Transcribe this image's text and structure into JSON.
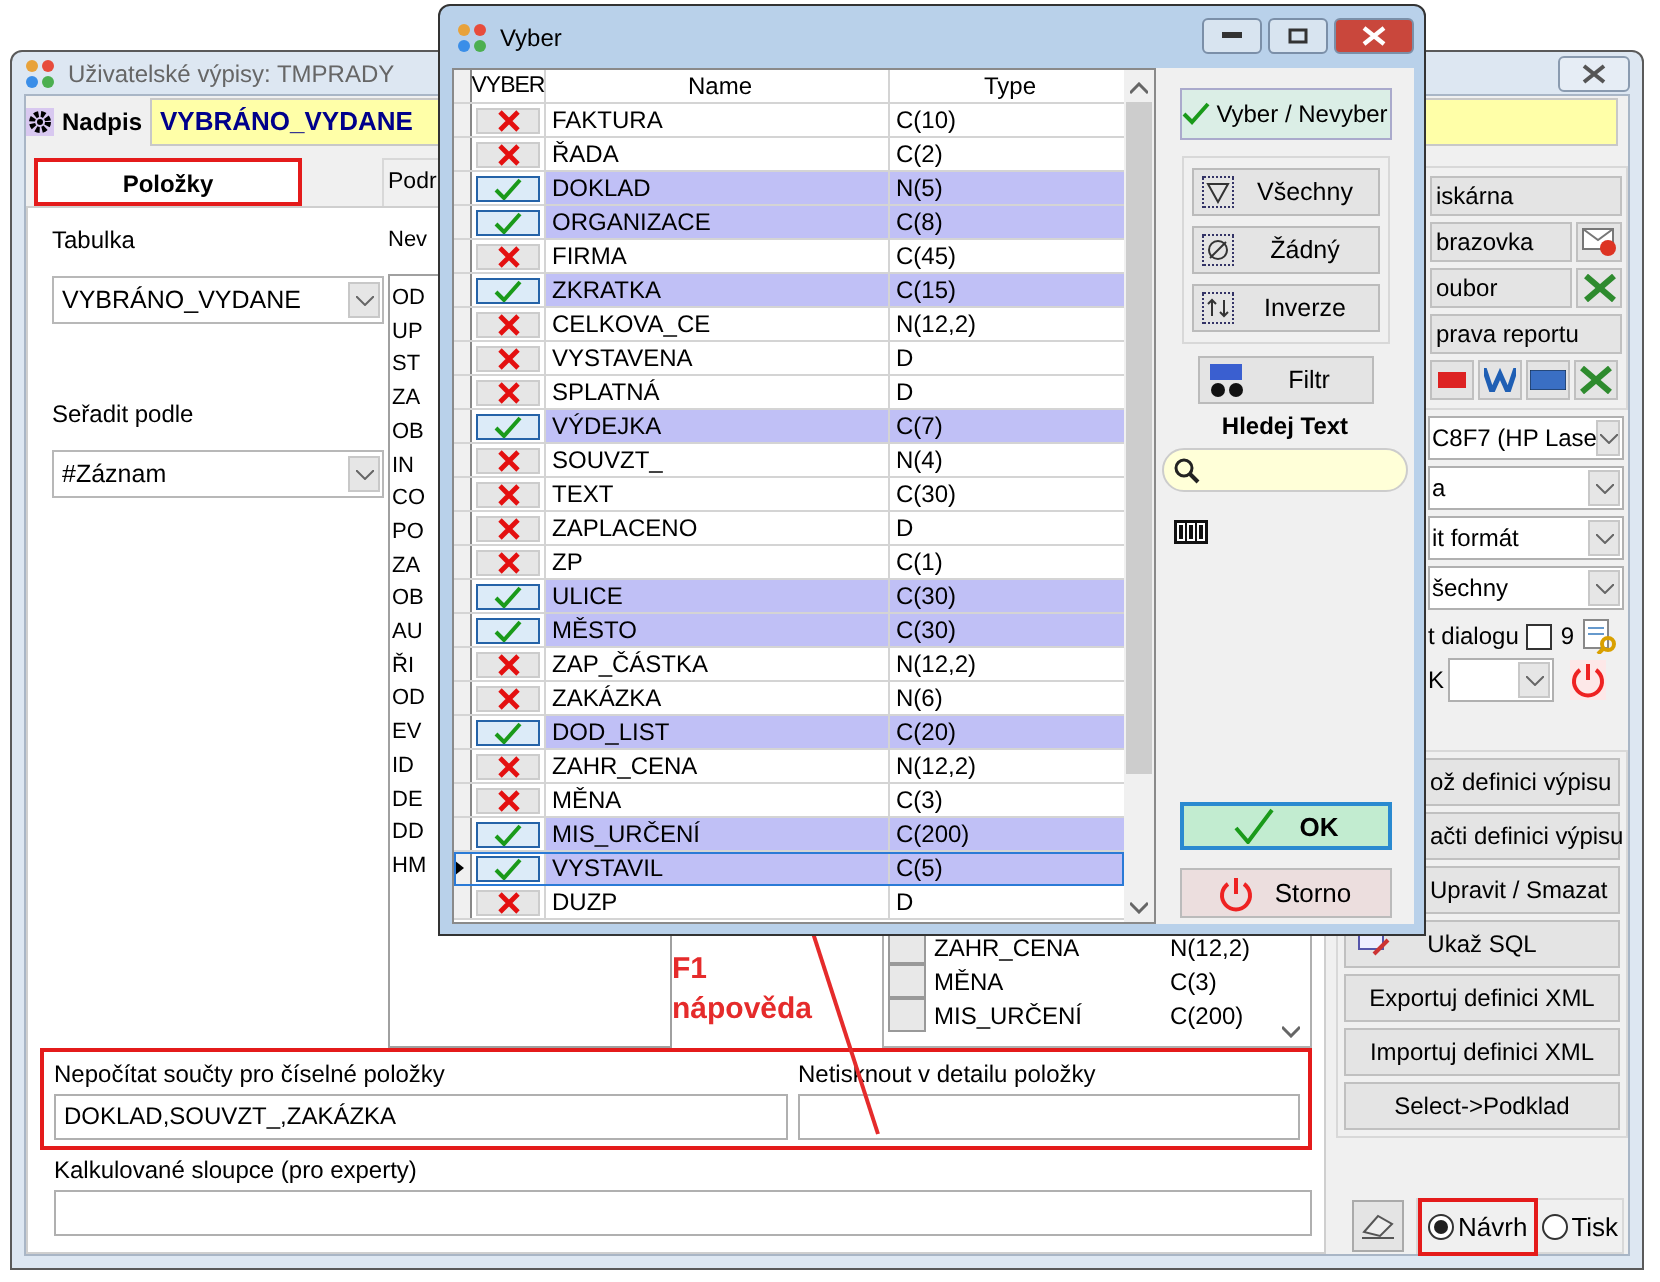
{
  "main_window": {
    "title": "Uživatelské výpisy: TMPRADY",
    "heading_label": "Nadpis",
    "heading_value": "VYBRÁNO_VYDANE",
    "tabs": [
      {
        "label": "Položky",
        "selected": true
      },
      {
        "label": "Podr",
        "selected": false
      }
    ],
    "table_label": "Tabulka",
    "table_value": "VYBRÁNO_VYDANE",
    "sort_label": "Seřadit podle",
    "sort_value": "#Záznam",
    "list_label": "Nev",
    "list_items": [
      "OD",
      "UP",
      "ST",
      "ZA",
      "OB",
      "IN",
      "CO",
      "PO",
      "ZA",
      "OB",
      "AU",
      "ŘI",
      "OD",
      "EV",
      "ID",
      "DE",
      "DD",
      "HM"
    ],
    "selected_fields": [
      {
        "name": "ZAHR_CENA",
        "type": "N(12,2)"
      },
      {
        "name": "MĚNA",
        "type": "C(3)"
      },
      {
        "name": "MIS_URČENÍ",
        "type": "C(200)"
      }
    ],
    "no_totals": {
      "label": "Nepočítat součty  pro číselné položky",
      "value": "DOKLAD,SOUVZT_,ZAKÁZKA"
    },
    "no_print_detail": {
      "label": "Netisknout v detailu položky"
    },
    "calculated_columns": {
      "label": "Kalkulované sloupce (pro experty)"
    },
    "printer_button": "iskárna",
    "screen_button": "brazovka",
    "file_button": "oubor",
    "report_edit_button": "prava reportu",
    "combos": [
      "C8F7 (HP Lase",
      "a",
      "it formát",
      "šechny"
    ],
    "dialog_option": {
      "label": "t dialogu",
      "checked": false,
      "count": "9"
    },
    "k_label": "K",
    "actions": [
      "ož definici výpisu",
      "ačti definici výpisu",
      "Upravit / Smazat",
      "Ukaž SQL",
      "Exportuj definici XML",
      "Importuj definici XML",
      "Select->Podklad"
    ],
    "modes": [
      {
        "label": "Návrh",
        "selected": true
      },
      {
        "label": "Tisk",
        "selected": false
      }
    ]
  },
  "dialog": {
    "title": "Vyber",
    "columns": [
      "VYBER",
      "Name",
      "Type"
    ],
    "rows": [
      {
        "name": "FAKTURA",
        "type": "C(10)",
        "checked": false,
        "selected": false
      },
      {
        "name": "ŘADA",
        "type": "C(2)",
        "checked": false,
        "selected": false
      },
      {
        "name": "DOKLAD",
        "type": "N(5)",
        "checked": true,
        "selected": false
      },
      {
        "name": "ORGANIZACE",
        "type": "C(8)",
        "checked": true,
        "selected": false
      },
      {
        "name": "FIRMA",
        "type": "C(45)",
        "checked": false,
        "selected": false
      },
      {
        "name": "ZKRATKA",
        "type": "C(15)",
        "checked": true,
        "selected": false
      },
      {
        "name": "CELKOVA_CE",
        "type": "N(12,2)",
        "checked": false,
        "selected": false
      },
      {
        "name": "VYSTAVENA",
        "type": "D",
        "checked": false,
        "selected": false
      },
      {
        "name": "SPLATNÁ",
        "type": "D",
        "checked": false,
        "selected": false
      },
      {
        "name": "VÝDEJKA",
        "type": "C(7)",
        "checked": true,
        "selected": false
      },
      {
        "name": "SOUVZT_",
        "type": "N(4)",
        "checked": false,
        "selected": false
      },
      {
        "name": "TEXT",
        "type": "C(30)",
        "checked": false,
        "selected": false
      },
      {
        "name": "ZAPLACENO",
        "type": "D",
        "checked": false,
        "selected": false
      },
      {
        "name": "ZP",
        "type": "C(1)",
        "checked": false,
        "selected": false
      },
      {
        "name": "ULICE",
        "type": "C(30)",
        "checked": true,
        "selected": false
      },
      {
        "name": "MĚSTO",
        "type": "C(30)",
        "checked": true,
        "selected": false
      },
      {
        "name": "ZAP_ČÁSTKA",
        "type": "N(12,2)",
        "checked": false,
        "selected": false
      },
      {
        "name": "ZAKÁZKA",
        "type": "N(6)",
        "checked": false,
        "selected": false
      },
      {
        "name": "DOD_LIST",
        "type": "C(20)",
        "checked": true,
        "selected": false
      },
      {
        "name": "ZAHR_CENA",
        "type": "N(12,2)",
        "checked": false,
        "selected": false
      },
      {
        "name": "MĚNA",
        "type": "C(3)",
        "checked": false,
        "selected": false
      },
      {
        "name": "MIS_URČENÍ",
        "type": "C(200)",
        "checked": true,
        "selected": false
      },
      {
        "name": "VYSTAVIL",
        "type": "C(5)",
        "checked": true,
        "selected": true
      },
      {
        "name": "DUZP",
        "type": "D",
        "checked": false,
        "selected": false
      }
    ],
    "toggle_button": "Vyber / Nevyber",
    "select_buttons": [
      "Všechny",
      "Žádný",
      "Inverze"
    ],
    "filter_button": "Filtr",
    "search_label": "Hledej Text",
    "ok_button": "OK",
    "cancel_button": "Storno"
  },
  "annotation": {
    "key": "F1",
    "text": "nápověda"
  }
}
